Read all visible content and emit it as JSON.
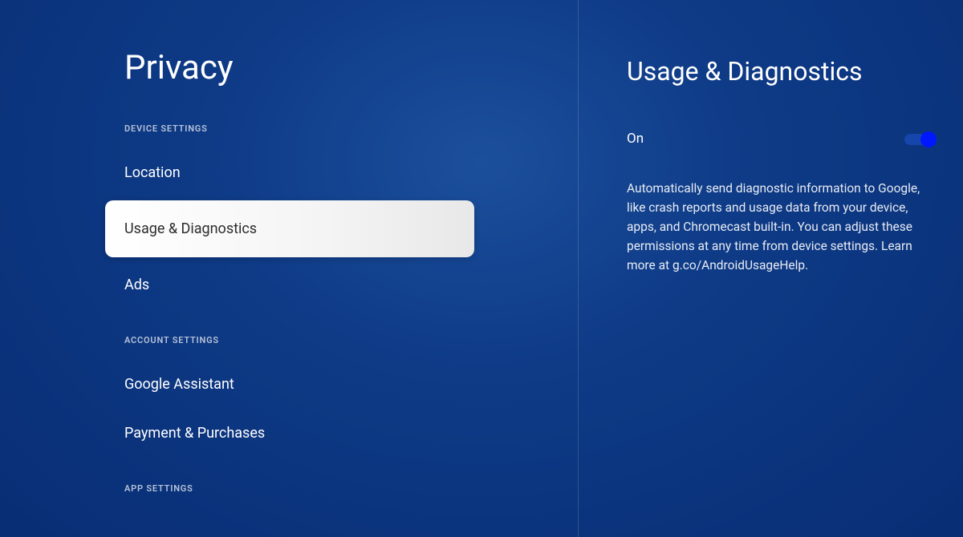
{
  "leftPanel": {
    "title": "Privacy",
    "sections": [
      {
        "label": "DEVICE SETTINGS",
        "items": [
          {
            "label": "Location",
            "selected": false
          },
          {
            "label": "Usage & Diagnostics",
            "selected": true
          },
          {
            "label": "Ads",
            "selected": false
          }
        ]
      },
      {
        "label": "ACCOUNT SETTINGS",
        "items": [
          {
            "label": "Google Assistant",
            "selected": false
          },
          {
            "label": "Payment & Purchases",
            "selected": false
          }
        ]
      },
      {
        "label": "APP SETTINGS",
        "items": []
      }
    ]
  },
  "rightPanel": {
    "title": "Usage & Diagnostics",
    "toggle": {
      "label": "On",
      "state": "on"
    },
    "description": "Automatically send diagnostic information to Google, like crash reports and usage data from your device, apps, and Chromecast built-in. You can adjust these permissions at any time from device settings. Learn more at g.co/AndroidUsageHelp."
  }
}
